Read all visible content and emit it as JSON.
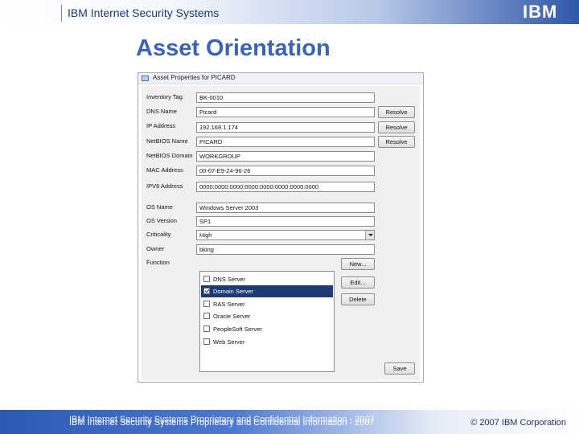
{
  "slide": {
    "company": "IBM Internet Security Systems",
    "logo": "IBM",
    "title": "Asset Orientation",
    "footer_confidential": "IBM Internet Security Systems Proprietary and Confidential Information - 2007",
    "footer_copyright": "© 2007 IBM Corporation",
    "colors": {
      "title": "#3a63b5",
      "header_blue": "#2f57a8",
      "selection": "#1c3a73"
    }
  },
  "dialog": {
    "title": "Asset Properties for PICARD",
    "fields": {
      "inventory_tag": {
        "label": "Inventory Tag",
        "value": "BK-0010"
      },
      "dns_name": {
        "label": "DNS Name",
        "value": "Picard"
      },
      "ip_address": {
        "label": "IP Address",
        "value": "192.168.1.174"
      },
      "netbios_name": {
        "label": "NetBIOS Name",
        "value": "PICARD"
      },
      "netbios_domain": {
        "label": "NetBIOS Domain",
        "value": "WORKGROUP"
      },
      "mac_address": {
        "label": "MAC Address",
        "value": "00-07-E9-24-96-26"
      },
      "ipv6_address": {
        "label": "IPV6 Address",
        "value": "0000:0000:0000:0000:0000:0000:0000:0000"
      },
      "os_name": {
        "label": "OS Name",
        "value": "Windows Server 2003"
      },
      "os_version": {
        "label": "OS Version",
        "value": "SP1"
      },
      "criticality": {
        "label": "Criticality",
        "value": "High"
      },
      "owner": {
        "label": "Owner",
        "value": "bking"
      },
      "function": {
        "label": "Function"
      }
    },
    "resolve_label": "Resolve",
    "functions": [
      {
        "label": "DNS Server",
        "checked": false,
        "selected": false
      },
      {
        "label": "Domain Server",
        "checked": true,
        "selected": true
      },
      {
        "label": "RAS Server",
        "checked": false,
        "selected": false
      },
      {
        "label": "Oracle Server",
        "checked": false,
        "selected": false
      },
      {
        "label": "PeopleSoft Server",
        "checked": false,
        "selected": false
      },
      {
        "label": "Web Server",
        "checked": false,
        "selected": false
      }
    ],
    "buttons": {
      "new": "New...",
      "edit": "Edit...",
      "delete": "Delete",
      "save": "Save"
    }
  }
}
